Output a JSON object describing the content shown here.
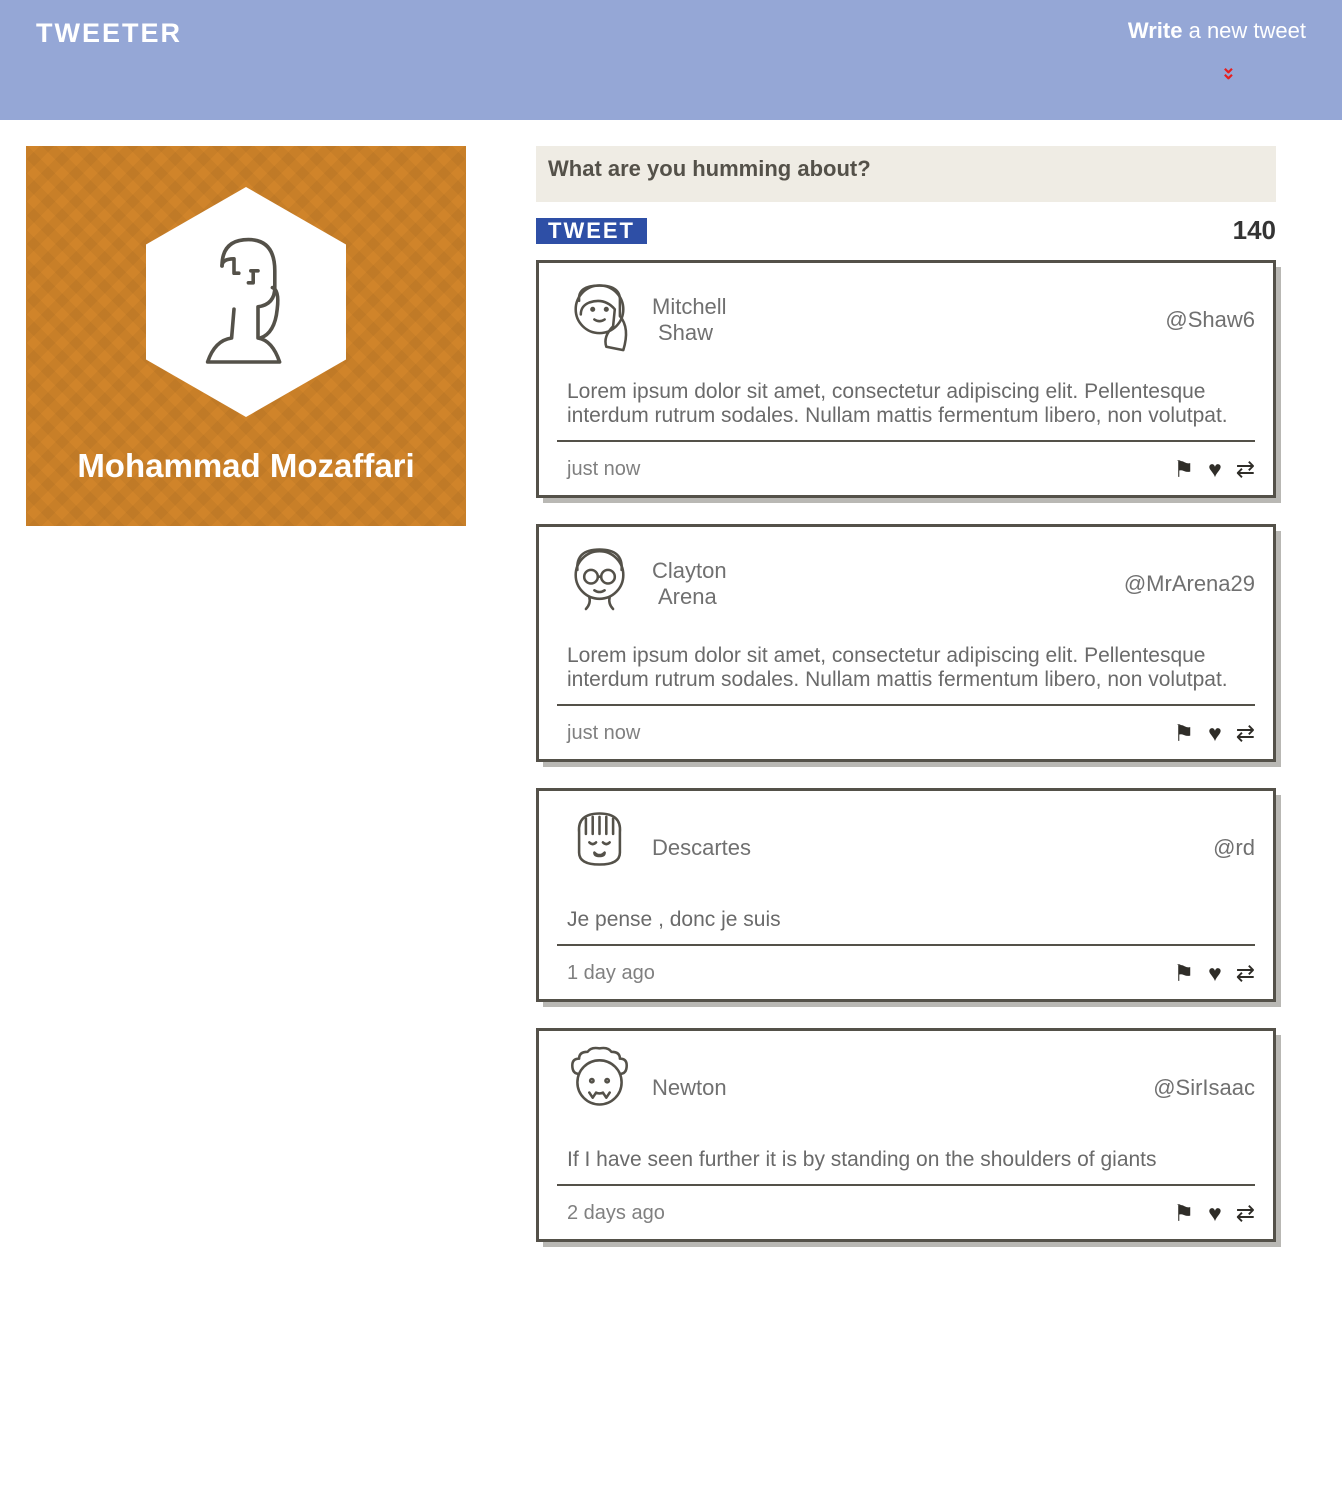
{
  "nav": {
    "brand": "tweeter",
    "write_bold": "Write",
    "write_rest": " a new tweet"
  },
  "profile": {
    "name": "Mohammad Mozaffari"
  },
  "compose": {
    "placeholder": "What are you humming about?",
    "button": "Tweet",
    "counter": "140"
  },
  "tweets": [
    {
      "avatar": "female-long-hair",
      "first": "Mitchell",
      "last": "Shaw",
      "handle": "@Shaw6",
      "body": "Lorem ipsum dolor sit amet, consectetur adipiscing elit. Pellentesque interdum rutrum sodales. Nullam mattis fermentum libero, non volutpat.",
      "time": "just now"
    },
    {
      "avatar": "person-glasses",
      "first": "Clayton",
      "last": "Arena",
      "handle": "@MrArena29",
      "body": "Lorem ipsum dolor sit amet, consectetur adipiscing elit. Pellentesque interdum rutrum sodales. Nullam mattis fermentum libero, non volutpat.",
      "time": "just now"
    },
    {
      "avatar": "girl-bangs",
      "first": "Descartes",
      "last": "",
      "handle": "@rd",
      "body": "Je pense , donc je suis",
      "time": "1 day ago"
    },
    {
      "avatar": "curly-fangs",
      "first": "Newton",
      "last": "",
      "handle": "@SirIsaac",
      "body": "If I have seen further it is by standing on the shoulders of giants",
      "time": "2 days ago"
    }
  ]
}
